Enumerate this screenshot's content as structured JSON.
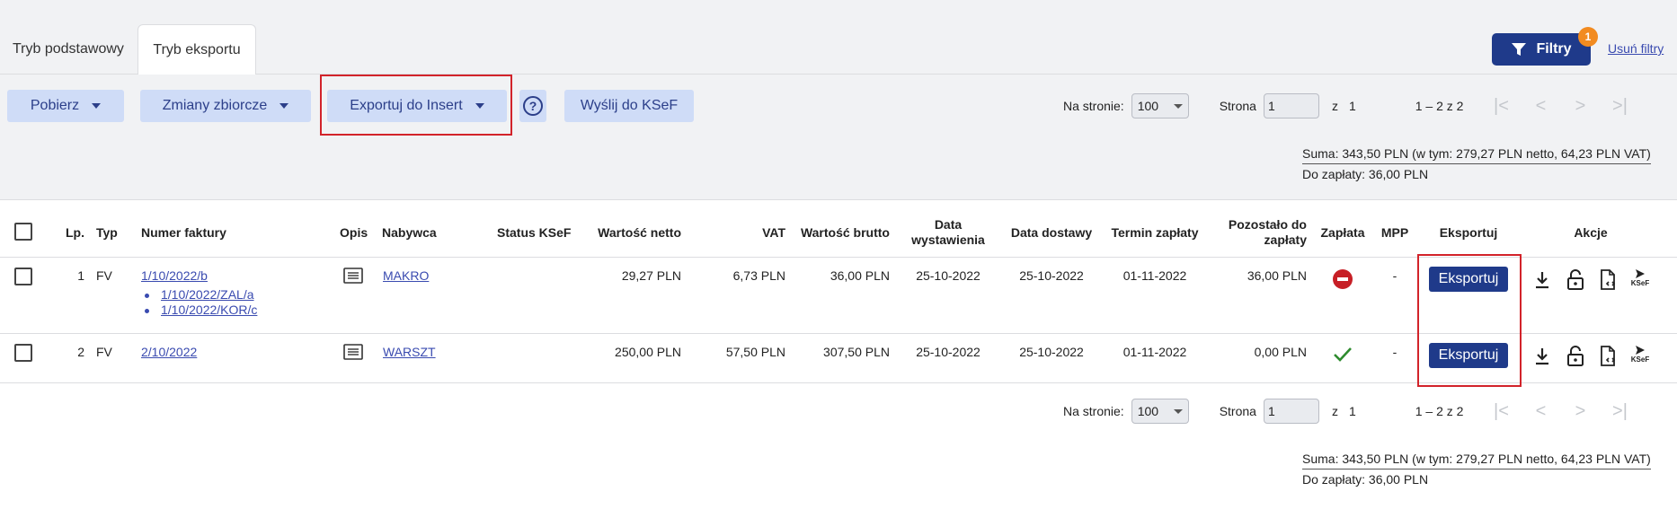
{
  "tabs": [
    {
      "label": "Tryb podstawowy"
    },
    {
      "label": "Tryb eksportu"
    }
  ],
  "filters": {
    "label": "Filtry",
    "badge": "1",
    "remove_label": "Usuń filtry"
  },
  "toolbar": {
    "pobierz": "Pobierz",
    "zmiany": "Zmiany zbiorcze",
    "exportuj": "Exportuj do Insert",
    "help": "?",
    "wyslij": "Wyślij do KSeF"
  },
  "pager": {
    "per_page_label": "Na stronie:",
    "per_page_value": "100",
    "page_label": "Strona",
    "page_value": "1",
    "of_label": "z",
    "total_pages": "1",
    "range": "1 – 2 z 2",
    "first": "|<",
    "prev": "<",
    "next": ">",
    "last": ">|"
  },
  "summary": {
    "line1": "Suma: 343,50 PLN (w tym: 279,27 PLN netto, 64,23 PLN VAT)",
    "line2": "Do zapłaty: 36,00 PLN"
  },
  "columns": {
    "lp": "Lp.",
    "typ": "Typ",
    "numer": "Numer faktury",
    "opis": "Opis",
    "nabywca": "Nabywca",
    "status": "Status KSeF",
    "netto": "Wartość netto",
    "vat": "VAT",
    "brutto": "Wartość brutto",
    "data_wyst_1": "Data",
    "data_wyst_2": "wystawienia",
    "data_dost": "Data dostawy",
    "termin": "Termin zapłaty",
    "pozostalo_1": "Pozostało do",
    "pozostalo_2": "zapłaty",
    "zaplata": "Zapłata",
    "mpp": "MPP",
    "eksportuj": "Eksportuj",
    "akcje": "Akcje"
  },
  "rows": [
    {
      "lp": "1",
      "typ": "FV",
      "numer": "1/10/2022/b",
      "sub_docs": [
        "1/10/2022/ZAL/a",
        "1/10/2022/KOR/c"
      ],
      "nabywca": "MAKRO",
      "netto": "29,27 PLN",
      "vat": "6,73 PLN",
      "brutto": "36,00 PLN",
      "data_wyst": "25-10-2022",
      "data_dost": "25-10-2022",
      "termin": "01-11-2022",
      "pozostalo": "36,00 PLN",
      "zaplata": "unpaid",
      "mpp": "-",
      "export_label": "Eksportuj"
    },
    {
      "lp": "2",
      "typ": "FV",
      "numer": "2/10/2022",
      "sub_docs": [],
      "nabywca": "WARSZT",
      "netto": "250,00 PLN",
      "vat": "57,50 PLN",
      "brutto": "307,50 PLN",
      "data_wyst": "25-10-2022",
      "data_dost": "25-10-2022",
      "termin": "01-11-2022",
      "pozostalo": "0,00 PLN",
      "zaplata": "paid",
      "mpp": "-",
      "export_label": "Eksportuj"
    }
  ],
  "ksef_icon_label": "KSeF",
  "colors": {
    "primary": "#1f3a8a",
    "light_button": "#cfdcf7",
    "highlight": "#d2232a",
    "badge": "#f28b20"
  }
}
